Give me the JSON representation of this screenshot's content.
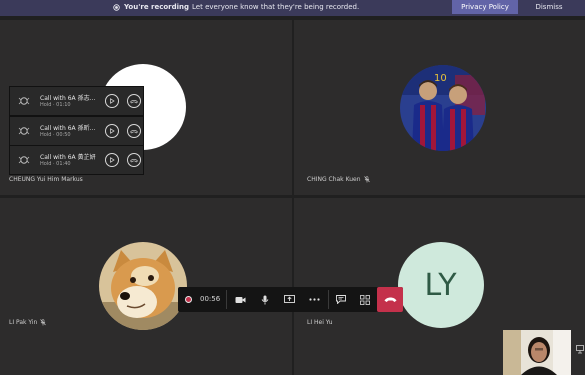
{
  "banner": {
    "icon": "recording-icon",
    "title": "You're recording",
    "message": "Let everyone know that they're being recorded.",
    "privacy_label": "Privacy Policy",
    "dismiss_label": "Dismiss"
  },
  "participants": [
    {
      "name": "CHEUNG Yui Him Markus",
      "muted": false,
      "avatar": "white-circle"
    },
    {
      "name": "CHING Chak Kuen",
      "muted": true,
      "avatar": "photo-two-footballers"
    },
    {
      "name": "LI Pak Yin",
      "muted": true,
      "avatar": "photo-shiba-dog"
    },
    {
      "name": "LI Hei Yu",
      "muted": false,
      "avatar": "initials",
      "initials": "LY",
      "avatar_color": "#cfe9dc"
    }
  ],
  "held_calls": [
    {
      "title": "Call with 6A 孫志…",
      "status": "Hold",
      "time": "01:10"
    },
    {
      "title": "Call with 6A 孫昕…",
      "status": "Hold",
      "time": "00:50"
    },
    {
      "title": "Call with 6A 黃芷妍",
      "status": "Hold",
      "time": "01:40"
    }
  ],
  "controls": {
    "timer": "00:56",
    "buttons": [
      "video-camera-icon",
      "microphone-icon",
      "share-screen-icon",
      "more-icon",
      "chat-icon",
      "participants-icon"
    ],
    "hangup": "hang-up-icon"
  },
  "colors": {
    "banner_bg": "#3b3a5a",
    "accent": "#6264a7",
    "hangup": "#c4314b",
    "tile_bg": "#2d2c2c"
  }
}
